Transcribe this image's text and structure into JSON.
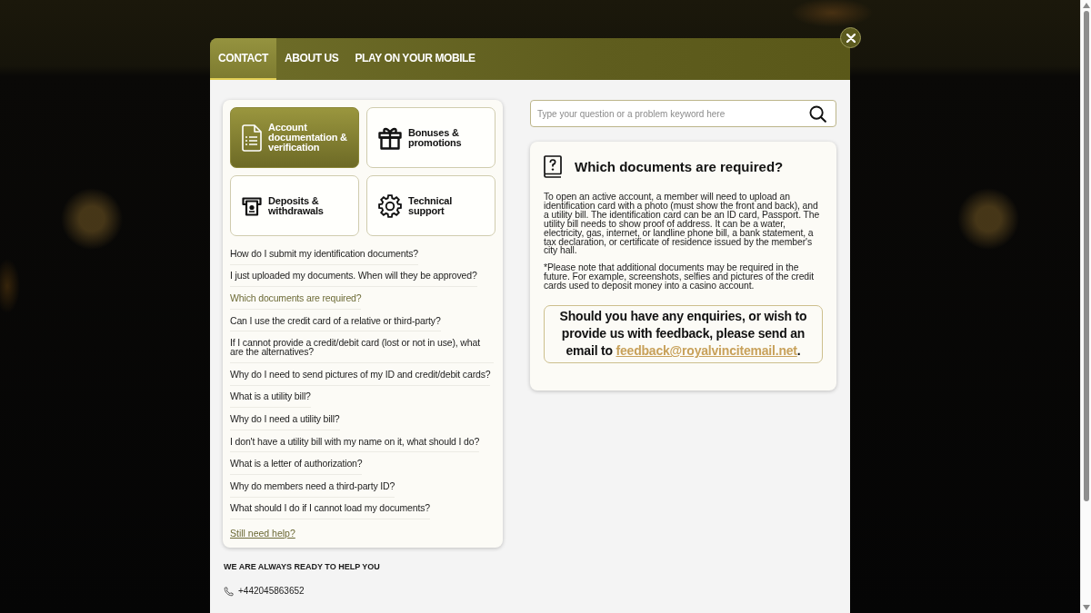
{
  "tabs": [
    {
      "label": "CONTACT",
      "selected": true
    },
    {
      "label": "ABOUT US",
      "selected": false
    },
    {
      "label": "PLAY ON YOUR MOBILE",
      "selected": false
    }
  ],
  "categories": [
    {
      "label": "Account documentation & verification",
      "selected": true
    },
    {
      "label": "Bonuses & promotions",
      "selected": false
    },
    {
      "label": "Deposits & withdrawals",
      "selected": false
    },
    {
      "label": "Technical support",
      "selected": false
    }
  ],
  "questions": {
    "items": [
      {
        "text": "How do I submit my identification documents?",
        "selected": false
      },
      {
        "text": "I just uploaded my documents. When will they be approved?",
        "selected": false
      },
      {
        "text": "Which documents are required?",
        "selected": true
      },
      {
        "text": "Can I use the credit card of a relative or third-party?",
        "selected": false
      },
      {
        "text": "If I cannot provide a credit/debit card (lost or not in use), what are the alternatives?",
        "selected": false
      },
      {
        "text": "Why do I need to send pictures of my ID and credit/debit cards?",
        "selected": false
      },
      {
        "text": "What is a utility bill?",
        "selected": false
      },
      {
        "text": "Why do I need a utility bill?",
        "selected": false
      },
      {
        "text": "I don't have a utility bill with my name on it, what should I do?",
        "selected": false
      },
      {
        "text": "What is a letter of authorization?",
        "selected": false
      },
      {
        "text": "Why do members need a third-party ID?",
        "selected": false
      },
      {
        "text": "What should I do if I cannot load my documents?",
        "selected": false
      }
    ],
    "more_link": "Still need help?"
  },
  "contact": {
    "heading": "WE ARE ALWAYS READY TO HELP YOU",
    "phone": "+442045863652"
  },
  "search": {
    "placeholder": "Type your question or a problem keyword here"
  },
  "answer": {
    "title": "Which documents are required?",
    "paragraphs": [
      "To open an active account, a member will need to upload an identification card with a photo (must show the front and back), and a utility bill. The identification card can be an ID card, Passport. The utility bill needs to show proof of address. It can be a water, electricity, gas, internet, or landline phone bill, a bank statement, a tax declaration, or certificate of residence issued by the member's city hall.",
      "*Please note that additional documents may be required in the future. For example, screenshots, selfies and pictures of the credit cards used to deposit money into a casino account."
    ],
    "feedback": {
      "text": "Should you have any enquiries, or wish to provide us with feedback, please send an email to",
      "email": "feedback@royalvincitemail.net",
      "suffix": "."
    }
  }
}
